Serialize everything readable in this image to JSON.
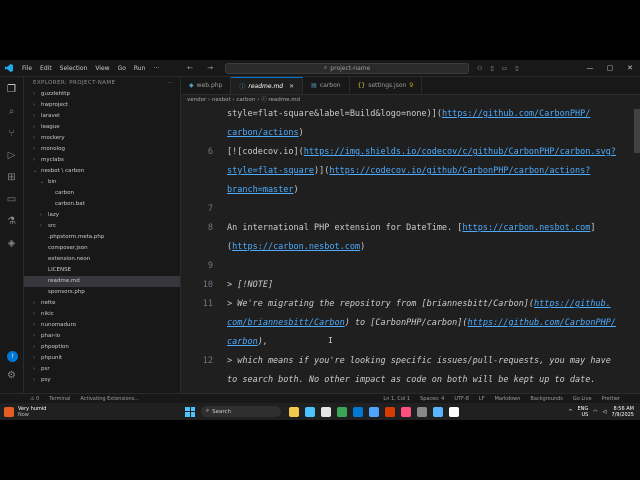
{
  "menu": [
    "File",
    "Edit",
    "Selection",
    "View",
    "Go",
    "Run"
  ],
  "nav_arrows": "←  →",
  "search_placeholder": "project-name",
  "window_controls": [
    "—",
    "▢",
    "✕"
  ],
  "activity": [
    "files-icon",
    "search-icon",
    "source-control-icon",
    "run-debug-icon",
    "extensions-icon",
    "remote-icon",
    "testing-icon",
    "docker-icon",
    "account-icon",
    "settings-icon"
  ],
  "sidebar": {
    "header": "EXPLORER: PROJECT-NAME",
    "items": [
      {
        "label": "guzzlehttp",
        "indent": 1,
        "kind": "folder",
        "sel": false
      },
      {
        "label": "hwproject",
        "indent": 1,
        "kind": "folder",
        "sel": false
      },
      {
        "label": "laravel",
        "indent": 1,
        "kind": "folder",
        "sel": false
      },
      {
        "label": "league",
        "indent": 1,
        "kind": "folder",
        "sel": false
      },
      {
        "label": "mockery",
        "indent": 1,
        "kind": "folder",
        "sel": false
      },
      {
        "label": "monolog",
        "indent": 1,
        "kind": "folder",
        "sel": false
      },
      {
        "label": "myclabs",
        "indent": 1,
        "kind": "folder",
        "sel": false
      },
      {
        "label": "nesbot \\ carbon",
        "indent": 1,
        "kind": "open",
        "sel": false
      },
      {
        "label": "bin",
        "indent": 2,
        "kind": "open",
        "sel": false
      },
      {
        "label": "carbon",
        "indent": 3,
        "kind": "file",
        "sel": false
      },
      {
        "label": "carbon.bat",
        "indent": 3,
        "kind": "file",
        "sel": false
      },
      {
        "label": "lazy",
        "indent": 2,
        "kind": "folder",
        "sel": false
      },
      {
        "label": "src",
        "indent": 2,
        "kind": "folder",
        "sel": false
      },
      {
        "label": ".phpstorm.meta.php",
        "indent": 2,
        "kind": "file",
        "sel": false
      },
      {
        "label": "composer.json",
        "indent": 2,
        "kind": "file",
        "sel": false
      },
      {
        "label": "extension.neon",
        "indent": 2,
        "kind": "file",
        "sel": false
      },
      {
        "label": "LICENSE",
        "indent": 2,
        "kind": "file",
        "sel": false
      },
      {
        "label": "readme.md",
        "indent": 2,
        "kind": "file",
        "sel": true
      },
      {
        "label": "sponsors.php",
        "indent": 2,
        "kind": "file",
        "sel": false
      },
      {
        "label": "nette",
        "indent": 1,
        "kind": "folder",
        "sel": false
      },
      {
        "label": "nikic",
        "indent": 1,
        "kind": "folder",
        "sel": false
      },
      {
        "label": "nunomaduro",
        "indent": 1,
        "kind": "folder",
        "sel": false
      },
      {
        "label": "phar-io",
        "indent": 1,
        "kind": "folder",
        "sel": false
      },
      {
        "label": "phpoption",
        "indent": 1,
        "kind": "folder",
        "sel": false
      },
      {
        "label": "phpunit",
        "indent": 1,
        "kind": "folder",
        "sel": false
      },
      {
        "label": "psr",
        "indent": 1,
        "kind": "folder",
        "sel": false
      },
      {
        "label": "psy",
        "indent": 1,
        "kind": "folder",
        "sel": false
      }
    ]
  },
  "tabs": [
    {
      "label": "web.php",
      "icon": "php-file-icon",
      "glyph": "◆",
      "active": false,
      "dirty": ""
    },
    {
      "label": "readme.md",
      "icon": "markdown-file-icon",
      "glyph": "ⓘ",
      "active": true,
      "dirty": ""
    },
    {
      "label": "carbon",
      "icon": "file-icon",
      "glyph": "▤",
      "active": false,
      "dirty": ""
    },
    {
      "label": "settings.json",
      "icon": "json-file-icon",
      "glyph": "{}",
      "active": false,
      "dirty": "9"
    }
  ],
  "breadcrumb": "vendor › nesbot › carbon › ⓘ readme.md",
  "code": [
    {
      "ln": "",
      "parts": [
        {
          "t": "style=flat-square&label=Build&logo=none)](",
          "c": ""
        },
        {
          "t": "https://github.com/CarbonPHP/",
          "c": "link"
        }
      ]
    },
    {
      "ln": "",
      "parts": [
        {
          "t": "carbon/actions",
          "c": "link"
        },
        {
          "t": ")",
          "c": ""
        }
      ]
    },
    {
      "ln": "6",
      "parts": [
        {
          "t": "[![codecov.io](",
          "c": ""
        },
        {
          "t": "https://img.shields.io/codecov/c/github/CarbonPHP/carbon.svg?",
          "c": "link"
        }
      ]
    },
    {
      "ln": "",
      "parts": [
        {
          "t": "style=flat-square",
          "c": "link"
        },
        {
          "t": ")](",
          "c": ""
        },
        {
          "t": "https://codecov.io/github/CarbonPHP/carbon/actions?",
          "c": "link"
        }
      ]
    },
    {
      "ln": "",
      "parts": [
        {
          "t": "branch=master",
          "c": "link"
        },
        {
          "t": ")",
          "c": ""
        }
      ]
    },
    {
      "ln": "7",
      "parts": []
    },
    {
      "ln": "8",
      "parts": [
        {
          "t": "An international PHP extension for DateTime. [",
          "c": ""
        },
        {
          "t": "https://carbon.nesbot.com",
          "c": "link"
        },
        {
          "t": "]",
          "c": ""
        }
      ]
    },
    {
      "ln": "",
      "parts": [
        {
          "t": "(",
          "c": ""
        },
        {
          "t": "https://carbon.nesbot.com",
          "c": "link"
        },
        {
          "t": ")",
          "c": ""
        }
      ]
    },
    {
      "ln": "9",
      "parts": []
    },
    {
      "ln": "10",
      "parts": [
        {
          "t": "> [!NOTE]",
          "c": ""
        }
      ]
    },
    {
      "ln": "11",
      "parts": [
        {
          "t": "> We're migrating the repository from [briannesbitt/Carbon](",
          "c": ""
        },
        {
          "t": "https://github.",
          "c": "link"
        }
      ]
    },
    {
      "ln": "",
      "parts": [
        {
          "t": "com/briannesbitt/Carbon",
          "c": "link"
        },
        {
          "t": ") to [CarbonPHP/carbon](",
          "c": ""
        },
        {
          "t": "https://github.com/CarbonPHP/",
          "c": "link"
        }
      ]
    },
    {
      "ln": "",
      "parts": [
        {
          "t": "carbon",
          "c": "link"
        },
        {
          "t": "),",
          "c": ""
        }
      ]
    },
    {
      "ln": "12",
      "parts": [
        {
          "t": "> which means if you're looking specific issues/pull-requests, you may have",
          "c": ""
        }
      ]
    },
    {
      "ln": "",
      "parts": [
        {
          "t": "to search both. No other impact as code on both will be kept up to date.",
          "c": ""
        }
      ]
    }
  ],
  "statusbar": {
    "left": [
      "⚠ 0",
      "Terminal",
      "Activating Extensions..."
    ],
    "right": [
      "Ln 1, Col 1",
      "Spaces: 4",
      "UTF-8",
      "LF",
      "Markdown",
      "Backgrounds",
      "Go Live",
      "Prettier"
    ]
  },
  "taskbar": {
    "weather_title": "Very humid",
    "weather_sub": "Now",
    "search_label": "Search",
    "apps": [
      "#f2c94c",
      "#4cc2ff",
      "#e5e5e5",
      "#3aa757",
      "#0078d4",
      "#4ea3ff",
      "#d83b01",
      "#ff4f81",
      "#888888",
      "#5ab4ff",
      "#ffffff"
    ],
    "lang": "ENG",
    "region": "US",
    "time": "8:56 AM",
    "date": "7/9/2025"
  }
}
